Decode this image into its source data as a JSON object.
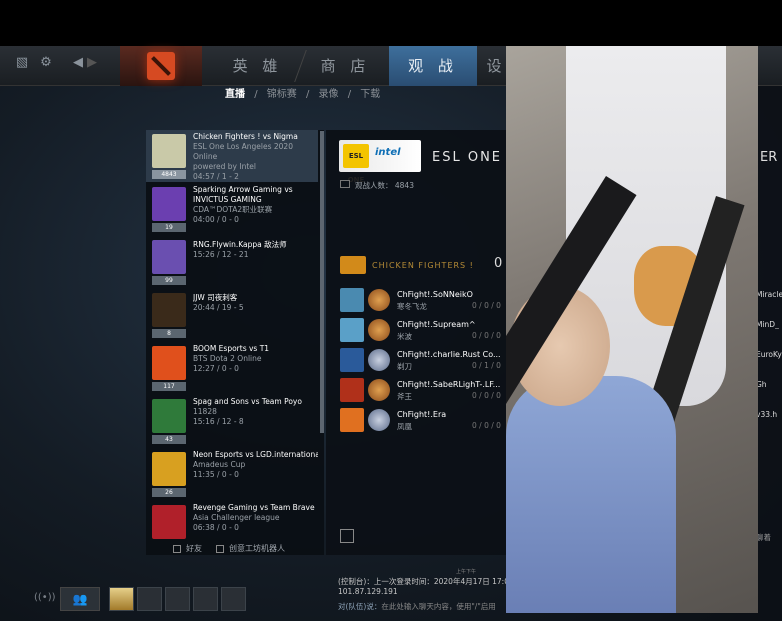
{
  "nav": {
    "tabs": [
      {
        "label": "英 雄"
      },
      {
        "label": "商 店"
      },
      {
        "label": "观 战"
      },
      {
        "label": "设"
      }
    ],
    "subnav": [
      "直播",
      "/",
      "锦标赛",
      "/",
      "录像",
      "/",
      "下载"
    ]
  },
  "matches": [
    {
      "title": "Chicken Fighters ! vs Nigma",
      "line2": "ESL One Los Angeles 2020 Online",
      "line3": "powered by Intel",
      "line4": "04:57 / 1 - 2",
      "viewers": "4843",
      "thumb_color": "#c9c9a8"
    },
    {
      "title": "Sparking Arrow Gaming vs",
      "title2": "INVICTUS GAMING",
      "line2": "CDA™DOTA2职业联赛",
      "line4": "04:00 / 0 - 0",
      "viewers": "19",
      "thumb_color": "#6b3fb0"
    },
    {
      "title": "RNG.Flywin.Kappa 敌法师",
      "line4": "15:26 / 12 - 21",
      "viewers": "99",
      "thumb_color": "#6a4fb0"
    },
    {
      "title": "JJW 司夜刺客",
      "line4": "20:44 / 19 - 5",
      "viewers": "8",
      "thumb_color": "#3a2a1a"
    },
    {
      "title": "BOOM Esports vs T1",
      "line2": "BTS Dota 2 Online",
      "line4": "12:27 / 0 - 0",
      "viewers": "117",
      "thumb_color": "#e0501c"
    },
    {
      "title": "Spag and Sons vs Team Poyo",
      "line2": "11828",
      "line4": "15:16 / 12 - 8",
      "viewers": "43",
      "thumb_color": "#2f7a3a"
    },
    {
      "title": "Neon Esports vs LGD.international",
      "line2": "Amadeus Cup",
      "line4": "11:35 / 0 - 0",
      "viewers": "26",
      "thumb_color": "#d8a020"
    },
    {
      "title": "Revenge Gaming vs Team Brave",
      "line2": "Asia Challenger league",
      "line4": "06:38 / 0 - 0",
      "viewers": "",
      "thumb_color": "#b0202a"
    }
  ],
  "filters": {
    "friends": "好友",
    "workshop": "创意工坊机器人"
  },
  "detail": {
    "title": "ESL ONE L",
    "viewers_label": "观战人数：",
    "viewers_value": "4843",
    "badge_left": "ESL ONE",
    "badge_right": "intel",
    "team": "CHICKEN FIGHTERS !",
    "team_score": "0",
    "players": [
      {
        "name": "ChFight!.SoNNeikO",
        "role": "寒冬飞龙",
        "kda": "0 / 0 / 0",
        "hero_color": "#4a8ab0"
      },
      {
        "name": "ChFight!.Supream^",
        "role": "米波",
        "kda": "0 / 0 / 0",
        "hero_color": "#5aa0c8"
      },
      {
        "name": "ChFight!.charlie.Rust Co...",
        "role": "剃刀",
        "kda": "0 / 1 / 0",
        "hero_color": "#2a5a9a"
      },
      {
        "name": "ChFight!.SabeRLighT-.LF...",
        "role": "斧王",
        "kda": "0 / 0 / 0",
        "hero_color": "#b0301a"
      },
      {
        "name": "ChFight!.Era",
        "role": "凤凰",
        "kda": "0 / 0 / 0",
        "hero_color": "#e07020"
      }
    ]
  },
  "chat": {
    "time": "上午下午",
    "line1": "(控制台)：上一次登录时间：2020年4月17日 17:0",
    "line2": "101.87.129.191",
    "line3_label": "对(队伍)说：",
    "line3": "在此处输入聊天内容，使用\"/\"启用"
  },
  "right_panel": {
    "title_fragment": "ER",
    "names": [
      "Miracle",
      "MinD_",
      "EuroKy",
      "Gh",
      "v33.h"
    ],
    "bottom": "聊着"
  }
}
